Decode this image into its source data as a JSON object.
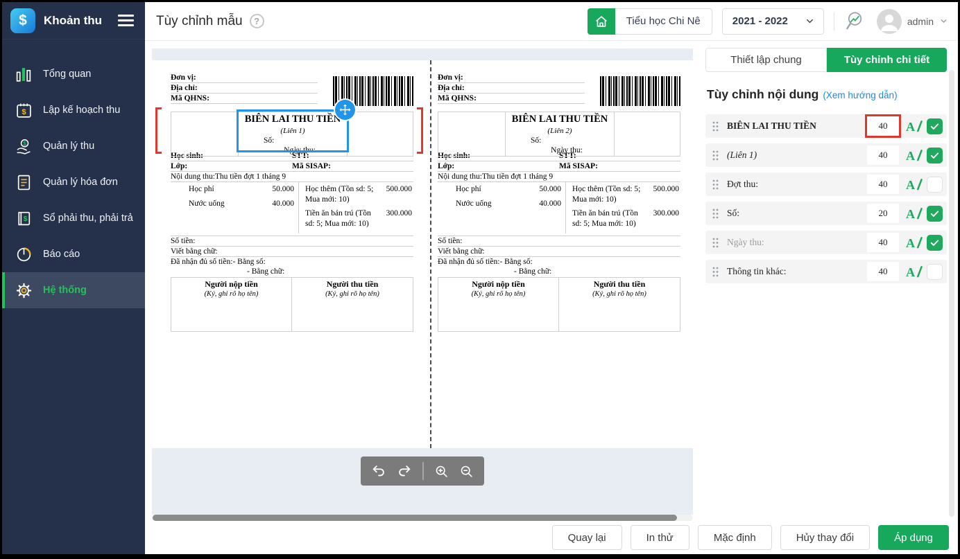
{
  "app": {
    "title": "Khoản thu",
    "logo_glyph": "$"
  },
  "sidebar": {
    "items": [
      {
        "label": "Tổng quan",
        "icon": "bar-chart",
        "active": false
      },
      {
        "label": "Lập kế hoạch thu",
        "icon": "calendar-dollar",
        "active": false
      },
      {
        "label": "Quản lý thu",
        "icon": "hand-money",
        "active": false
      },
      {
        "label": "Quản lý hóa đơn",
        "icon": "invoice-document",
        "active": false
      },
      {
        "label": "Sổ phải thu, phải trả",
        "icon": "ledger-book",
        "active": false
      },
      {
        "label": "Báo cáo",
        "icon": "pie-chart",
        "active": false
      },
      {
        "label": "Hệ thống",
        "icon": "gear",
        "active": true
      }
    ]
  },
  "header": {
    "title": "Tùy chỉnh mẫu",
    "help_glyph": "?",
    "school": "Tiểu học Chi Nê",
    "year": "2021 - 2022",
    "user": "admin"
  },
  "panel": {
    "tabs": [
      {
        "label": "Thiết lập chung",
        "active": false
      },
      {
        "label": "Tùy chỉnh chi tiết",
        "active": true
      }
    ],
    "heading": "Tùy chỉnh nội dung",
    "guide_link": "(Xem hướng dẫn)",
    "rows": [
      {
        "label": "BIÊN LAI THU TIỀN",
        "size": "40",
        "checked": true,
        "highlighted": true,
        "style": "bold"
      },
      {
        "label": "(Liên 1)",
        "size": "40",
        "checked": true,
        "highlighted": false,
        "style": "italic"
      },
      {
        "label": "Đợt thu:",
        "size": "40",
        "checked": false,
        "highlighted": false,
        "style": "normal"
      },
      {
        "label": "Số:",
        "size": "20",
        "checked": true,
        "highlighted": false,
        "style": "normal"
      },
      {
        "label": "Ngày thu:",
        "size": "40",
        "checked": true,
        "highlighted": false,
        "style": "muted"
      },
      {
        "label": "Thông tin khác:",
        "size": "40",
        "checked": false,
        "highlighted": false,
        "style": "normal"
      }
    ]
  },
  "receipt": {
    "unit_label": "Đơn vị:",
    "address_label": "Địa chỉ:",
    "qhns_label": "Mã QHNS:",
    "title": "BIÊN LAI THU TIỀN",
    "lien_1": "(Liên 1)",
    "lien_2": "(Liên 2)",
    "so_label": "Số:",
    "ngay_thu_label": "Ngày thu:",
    "student_label": "Học sinh:",
    "stt_label": "STT:",
    "class_label": "Lớp:",
    "sisap_label": "Mã SISAP:",
    "content_label": "Nội dung thu:",
    "content_value": "Thu tiền đợt 1 tháng 9",
    "fees_left": [
      {
        "name": "Học phí",
        "amount": "50.000"
      },
      {
        "name": "Nước uống",
        "amount": "40.000"
      }
    ],
    "fees_right": [
      {
        "name": "Học thêm (Tồn sd: 5; Mua mới: 10)",
        "amount": "500.000"
      },
      {
        "name": "Tiền ăn bán trú (Tồn sd: 5; Mua mới: 10)",
        "amount": "300.000"
      }
    ],
    "amount_label": "Số tiền:",
    "in_words_label": "Viết bằng chữ:",
    "received_label": "Đã nhận đủ số tiền:",
    "bang_so_label": "- Bằng số:",
    "bang_chu_label": "- Bằng chữ:",
    "payer_title": "Người nộp tiền",
    "collector_title": "Người thu tiền",
    "sign_note": "(Ký, ghi rõ họ tên)"
  },
  "canvas_toolbar": {
    "icons": [
      "undo",
      "redo",
      "zoom-in",
      "zoom-out"
    ]
  },
  "footer": {
    "buttons": [
      {
        "label": "Quay lại",
        "primary": false
      },
      {
        "label": "In thử",
        "primary": false
      },
      {
        "label": "Mặc định",
        "primary": false
      },
      {
        "label": "Hủy thay đổi",
        "primary": false
      },
      {
        "label": "Áp dụng",
        "primary": true
      }
    ]
  },
  "colors": {
    "accent_green": "#18a85c",
    "sidebar_navy": "#25314b",
    "selection_blue": "#2095e9",
    "highlight_red": "#e0372a",
    "link_blue": "#1e88e5"
  }
}
